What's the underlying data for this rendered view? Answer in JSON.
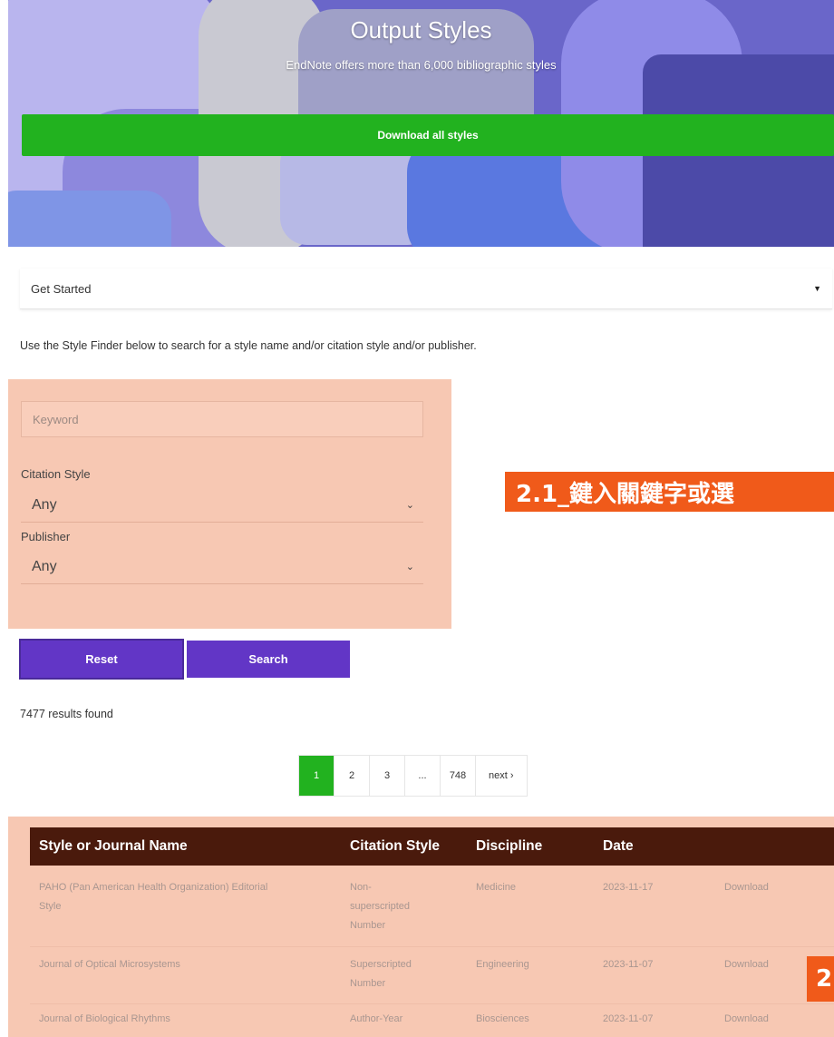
{
  "hero": {
    "title": "Output Styles",
    "subtitle": "EndNote offers more than 6,000 bibliographic styles",
    "download_all_label": "Download all styles"
  },
  "get_started": {
    "label": "Get Started"
  },
  "intro_text": "Use the Style Finder below to search for a style name and/or citation style and/or publisher.",
  "finder": {
    "keyword_placeholder": "Keyword",
    "citation_style_label": "Citation Style",
    "citation_style_value": "Any",
    "publisher_label": "Publisher",
    "publisher_value": "Any"
  },
  "buttons": {
    "reset": "Reset",
    "search": "Search"
  },
  "results_text": "7477 results found",
  "pagination": {
    "pages": [
      "1",
      "2",
      "3",
      "...",
      "748",
      "next ›"
    ],
    "active": "1"
  },
  "table": {
    "headers": [
      "Style or Journal Name",
      "Citation Style",
      "Discipline",
      "Date"
    ],
    "rows": [
      {
        "name_lines": [
          "PAHO (Pan American Health Organization) Editorial",
          "Style"
        ],
        "citation_lines": [
          "Non-",
          "superscripted",
          "Number"
        ],
        "discipline": "Medicine",
        "date": "2023-11-17",
        "action": "Download"
      },
      {
        "name_lines": [
          "Journal of Optical Microsystems"
        ],
        "citation_lines": [
          "Superscripted",
          "Number"
        ],
        "discipline": "Engineering",
        "date": "2023-11-07",
        "action": "Download"
      },
      {
        "name_lines": [
          "Journal of Biological Rhythms"
        ],
        "citation_lines": [
          "Author-Year"
        ],
        "discipline": "Biosciences",
        "date": "2023-11-07",
        "action": "Download"
      }
    ]
  },
  "annotations": {
    "label_1": "2.1_鍵入關鍵字或選",
    "label_2": "2"
  },
  "colors": {
    "green": "#22b21f",
    "purple": "#6236c6",
    "table_header": "#4a1a0c",
    "highlight": "#f7c8b3",
    "annotation": "#f05a1a"
  }
}
